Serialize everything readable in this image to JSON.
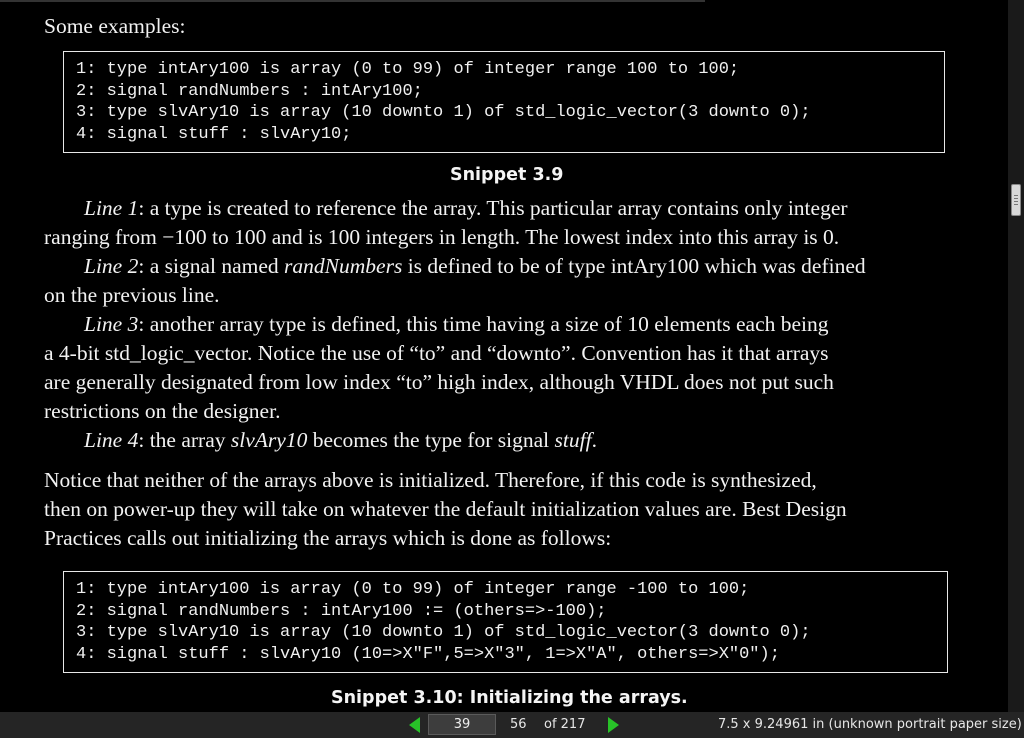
{
  "content": {
    "intro": "Some examples:",
    "snippet1": {
      "lines": [
        "1: type intAry100 is array (0 to 99) of integer range 100 to 100;",
        "2: signal randNumbers : intAry100;",
        "3: type slvAry10 is array (10 downto 1) of std_logic_vector(3 downto 0);",
        "4: signal stuff : slvAry10;"
      ],
      "caption": "Snippet 3.9"
    },
    "para1": {
      "label": "Line 1",
      "l1": ": a type is created to reference the array. This particular array contains only integer",
      "l2": "ranging from −100 to 100 and is 100 integers in length. The lowest index into this array is 0."
    },
    "para2": {
      "label": "Line 2",
      "a": ": a signal named ",
      "b": "randNumbers",
      "c": " is defined to be of type intAry100 which was defined",
      "l2": "on the previous line."
    },
    "para3": {
      "label": "Line 3",
      "l1": ": another array type is defined, this time having a size of 10 elements each being",
      "l2": "a 4-bit std_logic_vector. Notice the use of “to” and “downto”. Convention has it that arrays",
      "l3": "are generally designated from low index “to” high index, although VHDL does not put such",
      "l4": "restrictions on the designer."
    },
    "para4": {
      "label": "Line 4",
      "a": ": the array ",
      "b": "slvAry10",
      "c": " becomes the type for signal ",
      "d": "stuff",
      "e": "."
    },
    "para5": {
      "l1": "Notice that neither of the arrays above is initialized. Therefore, if this code is synthesized,",
      "l2": "then on power-up they will take on whatever the default initialization values are. Best Design",
      "l3": "Practices calls out initializing the arrays which is done as follows:"
    },
    "snippet2": {
      "lines": [
        "1: type intAry100 is array (0 to 99) of integer range -100 to 100;",
        "2: signal randNumbers : intAry100 := (others=>-100);",
        "3: type slvAry10 is array (10 downto 1) of std_logic_vector(3 downto 0);",
        "4: signal stuff : slvAry10 (10=>X\"F\",5=>X\"3\", 1=>X\"A\", others=>X\"0\");"
      ],
      "caption": "Snippet 3.10: Initializing the arrays."
    }
  },
  "statusbar": {
    "page_input": "39",
    "current_page": "56",
    "of_label": "of 217",
    "paper_size": "7.5 x 9.24961 in (unknown portrait paper size)"
  },
  "icons": {
    "prev": "triangle-left-icon",
    "next": "triangle-right-icon",
    "accent_color": "#28c228"
  }
}
